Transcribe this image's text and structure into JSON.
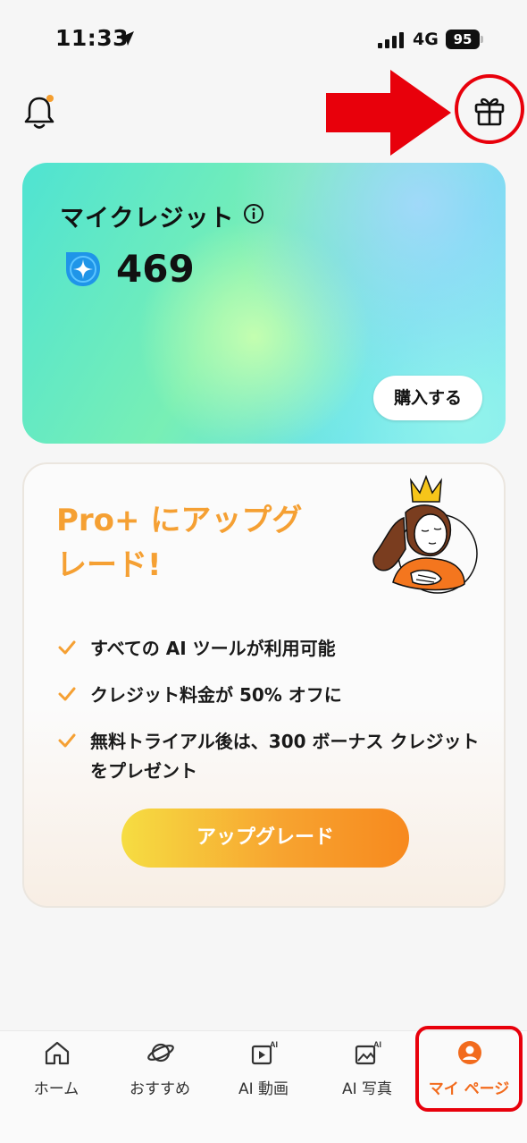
{
  "status_bar": {
    "time": "11:33",
    "network": "4G",
    "battery": "95"
  },
  "credits": {
    "title": "マイクレジット",
    "value": "469",
    "buy_label": "購入する"
  },
  "upgrade": {
    "title_line1": "Pro+ にアップグ",
    "title_line2": "レード!",
    "features": [
      {
        "text": "すべての AI ツールが利用可能"
      },
      {
        "text": "クレジット料金が 50% オフに"
      },
      {
        "text": "無料トライアル後は、300 ボーナス クレジットをプレゼント"
      }
    ],
    "button_label": "アップグレード"
  },
  "nav": {
    "items": [
      {
        "label": "ホーム",
        "icon": "home-icon"
      },
      {
        "label": "おすすめ",
        "icon": "planet-icon"
      },
      {
        "label": "AI 動画",
        "icon": "ai-video-icon"
      },
      {
        "label": "AI 写真",
        "icon": "ai-photo-icon"
      },
      {
        "label": "マイ ページ",
        "icon": "user-icon"
      }
    ],
    "active_index": 4
  },
  "colors": {
    "accent": "#f26b1d",
    "highlight_red": "#e8000b",
    "title_orange": "#f5a033"
  }
}
